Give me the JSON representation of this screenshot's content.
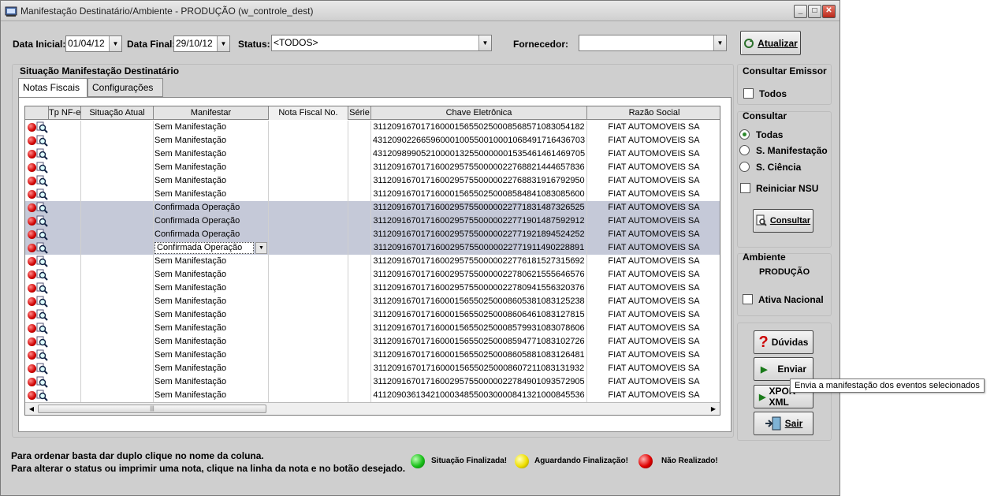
{
  "window": {
    "title": "Manifestação Destinatário/Ambiente - PRODUÇÃO (w_controle_dest)",
    "min_label": "_",
    "max_label": "□",
    "close_label": "✕"
  },
  "filters": {
    "data_inicial_label": "Data Inicial:",
    "data_inicial_value": "01/04/12",
    "data_final_label": "Data Final:",
    "data_final_value": "29/10/12",
    "status_label": "Status:",
    "status_value": "<TODOS>",
    "fornecedor_label": "Fornecedor:",
    "fornecedor_value": "",
    "atualizar_label": "Atualizar"
  },
  "section_title": "Situação Manifestação Destinatário",
  "tabs": [
    {
      "label": "Notas Fiscais",
      "active": true
    },
    {
      "label": "Configurações",
      "active": false
    }
  ],
  "grid": {
    "columns": [
      "Tp NF-e",
      "Situação Atual",
      "Manifestar",
      "Nota Fiscal No.",
      "Série",
      "Chave Eletrônica",
      "Razão Social"
    ],
    "rows": [
      {
        "manifestar": "Sem Manifestação",
        "chave": "31120916701716000156550250008568571083054182",
        "razao": "FIAT AUTOMOVEIS SA",
        "selected": false
      },
      {
        "manifestar": "Sem Manifestação",
        "chave": "43120902266596000100550010001068491716436703",
        "razao": "FIAT AUTOMOVEIS SA",
        "selected": false
      },
      {
        "manifestar": "Sem Manifestação",
        "chave": "43120989905210000132550000001535461461469705",
        "razao": "FIAT AUTOMOVEIS SA",
        "selected": false
      },
      {
        "manifestar": "Sem Manifestação",
        "chave": "31120916701716002957550000022768821444657836",
        "razao": "FIAT AUTOMOVEIS SA",
        "selected": false
      },
      {
        "manifestar": "Sem Manifestação",
        "chave": "31120916701716002957550000022768831916792950",
        "razao": "FIAT AUTOMOVEIS SA",
        "selected": false
      },
      {
        "manifestar": "Sem Manifestação",
        "chave": "31120916701716000156550250008584841083085600",
        "razao": "FIAT AUTOMOVEIS SA",
        "selected": false
      },
      {
        "manifestar": "Confirmada Operação",
        "chave": "31120916701716002957550000022771831487326525",
        "razao": "FIAT AUTOMOVEIS SA",
        "selected": true
      },
      {
        "manifestar": "Confirmada Operação",
        "chave": "31120916701716002957550000022771901487592912",
        "razao": "FIAT AUTOMOVEIS SA",
        "selected": true
      },
      {
        "manifestar": "Confirmada Operação",
        "chave": "31120916701716002957550000022771921894524252",
        "razao": "FIAT AUTOMOVEIS SA",
        "selected": true
      },
      {
        "manifestar": "Confirmada Operação",
        "chave": "31120916701716002957550000022771911490228891",
        "razao": "FIAT AUTOMOVEIS SA",
        "selected": true,
        "editing": true
      },
      {
        "manifestar": "Sem Manifestação",
        "chave": "31120916701716002957550000022776181527315692",
        "razao": "FIAT AUTOMOVEIS SA",
        "selected": false
      },
      {
        "manifestar": "Sem Manifestação",
        "chave": "31120916701716002957550000022780621555646576",
        "razao": "FIAT AUTOMOVEIS SA",
        "selected": false
      },
      {
        "manifestar": "Sem Manifestação",
        "chave": "31120916701716002957550000022780941556320376",
        "razao": "FIAT AUTOMOVEIS SA",
        "selected": false
      },
      {
        "manifestar": "Sem Manifestação",
        "chave": "31120916701716000156550250008605381083125238",
        "razao": "FIAT AUTOMOVEIS SA",
        "selected": false
      },
      {
        "manifestar": "Sem Manifestação",
        "chave": "31120916701716000156550250008606461083127815",
        "razao": "FIAT AUTOMOVEIS SA",
        "selected": false
      },
      {
        "manifestar": "Sem Manifestação",
        "chave": "31120916701716000156550250008579931083078606",
        "razao": "FIAT AUTOMOVEIS SA",
        "selected": false
      },
      {
        "manifestar": "Sem Manifestação",
        "chave": "31120916701716000156550250008594771083102726",
        "razao": "FIAT AUTOMOVEIS SA",
        "selected": false
      },
      {
        "manifestar": "Sem Manifestação",
        "chave": "31120916701716000156550250008605881083126481",
        "razao": "FIAT AUTOMOVEIS SA",
        "selected": false
      },
      {
        "manifestar": "Sem Manifestação",
        "chave": "31120916701716000156550250008607211083131932",
        "razao": "FIAT AUTOMOVEIS SA",
        "selected": false
      },
      {
        "manifestar": "Sem Manifestação",
        "chave": "31120916701716002957550000022784901093572905",
        "razao": "FIAT AUTOMOVEIS SA",
        "selected": false
      },
      {
        "manifestar": "Sem Manifestação",
        "chave": "41120903613421000348550030000841321000845536",
        "razao": "FIAT AUTOMOVEIS SA",
        "selected": false
      }
    ]
  },
  "right_panel": {
    "consultar_emissor_title": "Consultar Emissor",
    "todos_label": "Todos",
    "consultar_title": "Consultar",
    "radio_options": [
      {
        "label": "Todas",
        "checked": true
      },
      {
        "label": "S. Manifestação",
        "checked": false
      },
      {
        "label": "S. Ciência",
        "checked": false
      }
    ],
    "reiniciar_label": "Reiniciar NSU",
    "consultar_button": "Consultar",
    "ambiente_title": "Ambiente",
    "ambiente_value": "PRODUÇÃO",
    "ativa_nacional_label": "Ativa Nacional",
    "duvidas_button": "Dúvidas",
    "enviar_button": "Enviar",
    "expor_button": "XPOR XML",
    "sair_button": "Sair"
  },
  "tooltip": "Envia a manifestação dos eventos selecionados",
  "footer": {
    "line1": "Para ordenar basta dar duplo clique no nome da coluna.",
    "line2": "Para alterar o status ou imprimir uma nota, clique na linha da nota e no botão desejado.",
    "legend": [
      {
        "color": "green",
        "label": "Situação Finalizada!"
      },
      {
        "color": "yellow",
        "label": "Aguardando Finalização!"
      },
      {
        "color": "red",
        "label": "Não Realizado!"
      }
    ]
  }
}
